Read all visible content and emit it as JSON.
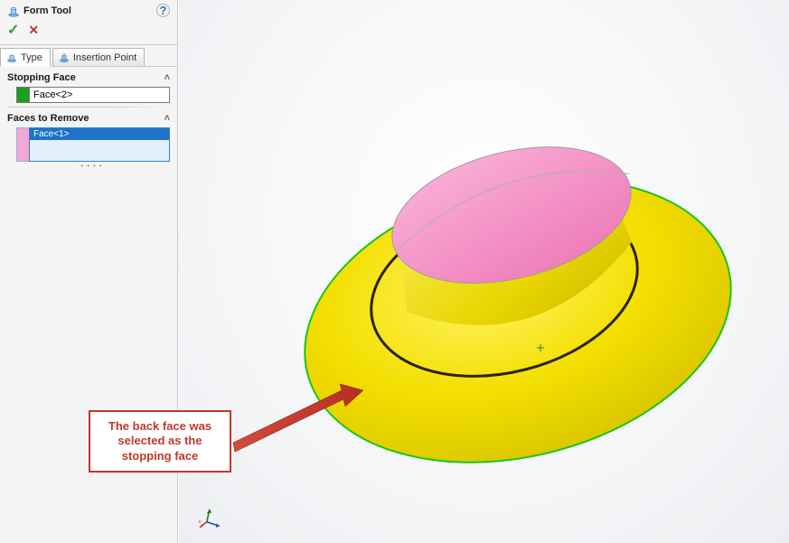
{
  "panel": {
    "title": "Form Tool",
    "tabs": {
      "type": "Type",
      "insertion": "Insertion Point"
    },
    "sections": {
      "stopping_face": {
        "header": "Stopping Face",
        "value": "Face<2>"
      },
      "faces_to_remove": {
        "header": "Faces to Remove",
        "items": [
          "Face<1>"
        ]
      }
    }
  },
  "callout": {
    "text": "The back face was selected as the stopping face"
  },
  "icons": {
    "help": "?",
    "ok": "✓",
    "cancel": "✕",
    "chevron_up": "˄",
    "collapse": "‹"
  },
  "colors": {
    "stopping_swatch": "#1aa01a",
    "remove_swatch": "#f4a6d5",
    "callout_border": "#c0392b",
    "model_top": "#f48fc1",
    "model_side": "#f6e33a",
    "model_flange": "#f3df00",
    "model_edge": "#19c419"
  }
}
